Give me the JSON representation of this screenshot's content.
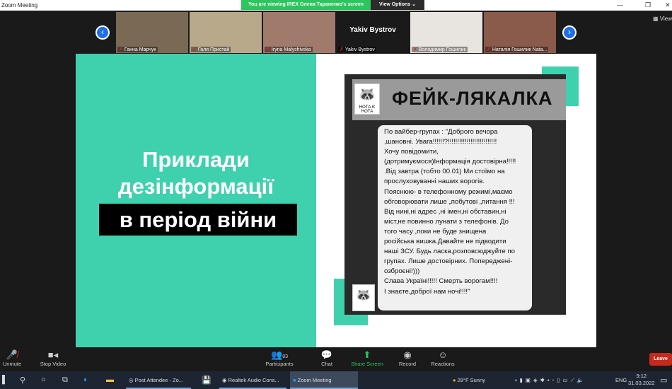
{
  "window": {
    "title": "Zoom Meeting"
  },
  "banner": {
    "viewing": "You are viewing IREX Олена Тараненко's screen",
    "view_options": "View Options ⌄"
  },
  "participants": [
    {
      "name": "Ганна Марчук",
      "color": "#7a6a55"
    },
    {
      "name": "Галя Пристай",
      "color": "#b8a98a"
    },
    {
      "name": "Iryna Malyshivska",
      "color": "#a07a6a"
    },
    {
      "name": "Yakiv Bystrov",
      "color": "#1a1a1a",
      "display": "Yakiv Bystrov"
    },
    {
      "name": "Володимир Гошилик",
      "color": "#e8e4e0"
    },
    {
      "name": "Наталія Гошилик Nata...",
      "color": "#8a5a4a"
    }
  ],
  "view_label": "View",
  "slide": {
    "title_line1": "Приклади",
    "title_line2": "дезінформації",
    "title_line3": "в період війни",
    "image_title": "ФЕЙК-ЛЯКАЛКА",
    "logo_text": "НОТА Є НОТА",
    "message": "По вайбер-групах : \"Доброго вечора\n,шановні. Увага!!!!!!?!!!!!!!!!!!!!!!!!!!!!!!!!!\nХочу повідомити,\n(дотримуємося)Інформація достовірна!!!!!\n.Від завтра (тобто 00.01) Ми стоїмо на\nпрослуховуванні наших ворогів.\nПояснюю- в телефонному режимі,маємо\nобговорювати лише „побутові „питання !!!\nВід нині,ні адрес ,ні імен,ні обставин,ні\nміст,не повинно лунати з телефонів. До\nтого часу ,поки не буде знищена\nросійська вишка.Давайте не підводити\nнаші ЗСУ. Будь ласка,розповсюджуйте по\nгрупах. Лише достовірних. Попереджені-\nозброєні!)))\nСлава Україні!!!!! Смерть ворогам!!!!\nІ знаєте,доброї нам ночі!!!!\""
  },
  "toolbar": {
    "unmute": "Unmute",
    "stop_video": "Stop Video",
    "participants": "Participants",
    "participant_count": "83",
    "chat": "Chat",
    "share_screen": "Share Screen",
    "record": "Record",
    "reactions": "Reactions",
    "leave": "Leave"
  },
  "taskbar": {
    "apps": [
      "Post Attendee - Zo...",
      "Realtek Audio Cons...",
      "Zoom Meeting"
    ],
    "weather": "29°F  Sunny",
    "lang": "ENG",
    "time": "9:12",
    "date": "31.03.2022"
  },
  "colors": {
    "accent": "#3fd1ad",
    "share_green": "#2dc55e",
    "leave_red": "#c42b1c"
  }
}
